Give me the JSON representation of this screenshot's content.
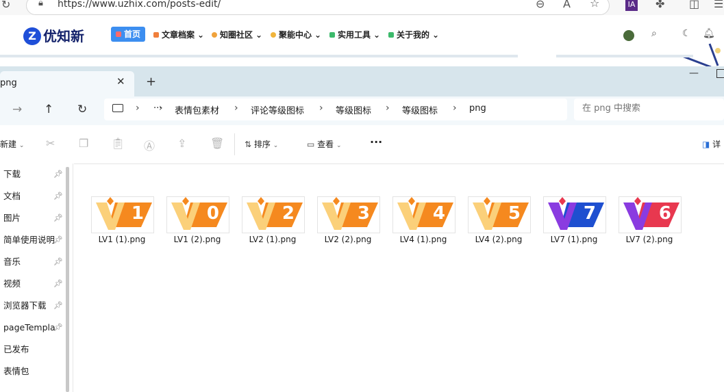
{
  "browser": {
    "url": "https://www.uzhix.com/posts-edit/",
    "profile_badge": "IA"
  },
  "site": {
    "logo_text": "优知新",
    "logo_mark": "Z",
    "nav": [
      {
        "label": "首页",
        "color": "#ff6a6a"
      },
      {
        "label": "文章档案",
        "color": "#f07f3c"
      },
      {
        "label": "知圈社区",
        "color": "#f0a23c"
      },
      {
        "label": "聚能中心",
        "color": "#f0b43c"
      },
      {
        "label": "实用工具",
        "color": "#3cba6b"
      },
      {
        "label": "关于我的",
        "color": "#3cba6b"
      }
    ]
  },
  "explorer": {
    "tab_title": "png",
    "breadcrumb": [
      "表情包素材",
      "评论等级图标",
      "等级图标",
      "等级图标",
      "png"
    ],
    "more_crumb": "···",
    "search_placeholder": "在 png 中搜索",
    "toolbar": {
      "new_label": "新建",
      "sort_label": "排序",
      "view_label": "查看",
      "more_label": "···",
      "details_label": "详"
    },
    "sidebar_items": [
      {
        "label": "下载",
        "pinned": true
      },
      {
        "label": "文档",
        "pinned": true
      },
      {
        "label": "图片",
        "pinned": true
      },
      {
        "label": "简单使用说明",
        "pinned": true
      },
      {
        "label": "音乐",
        "pinned": true
      },
      {
        "label": "视频",
        "pinned": true
      },
      {
        "label": "浏览器下载",
        "pinned": true
      },
      {
        "label": "pageTemplate",
        "pinned": true
      },
      {
        "label": "已发布",
        "pinned": false
      },
      {
        "label": "表情包",
        "pinned": false
      }
    ],
    "files": [
      {
        "name": "LV1 (1).png",
        "badge": "1",
        "style": "orange"
      },
      {
        "name": "LV1 (2).png",
        "badge": "0",
        "style": "orange"
      },
      {
        "name": "LV2 (1).png",
        "badge": "2",
        "style": "orange"
      },
      {
        "name": "LV2 (2).png",
        "badge": "3",
        "style": "orange"
      },
      {
        "name": "LV4 (1).png",
        "badge": "4",
        "style": "orange"
      },
      {
        "name": "LV4 (2).png",
        "badge": "5",
        "style": "orange"
      },
      {
        "name": "LV7 (1).png",
        "badge": "7",
        "style": "blue"
      },
      {
        "name": "LV7 (2).png",
        "badge": "6",
        "style": "red"
      }
    ]
  },
  "colors": {
    "badge_orange": "#f5891f",
    "badge_orange_light": "#fbd07a",
    "badge_blue": "#1e4fd0",
    "badge_red": "#e8384f",
    "badge_purple": "#8a3be0"
  }
}
